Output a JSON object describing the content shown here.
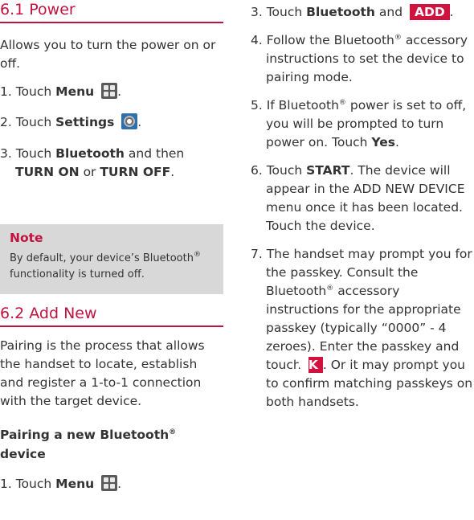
{
  "left": {
    "power_heading": "6.1 Power",
    "power_intro": "Allows you to turn the power on or off.",
    "power_step1_prefix": "1. Touch",
    "power_step1_menu": "Menu",
    "power_step2_prefix": "2. Touch",
    "power_step2_settings": "Settings",
    "power_step3_prefix": "3. Touch",
    "power_step3_bluetooth": "Bluetooth",
    "power_step3_mid": "and then",
    "power_step3_on": "TURN ON",
    "power_step3_or": "or",
    "power_step3_off": "TURN OFF",
    "power_step3_end": ".",
    "note_title": "Note",
    "note_text_1": "By default, your device’s Bluetooth",
    "note_text_2": "functionality is turned off.",
    "add_heading": "6.2 Add New",
    "add_intro": "Pairing is the process that allows the handset to locate, establish and register a 1-to-1 connection with the target device.",
    "pair_heading_1": "Pairing a new Bluetooth",
    "pair_heading_2": "device",
    "add_step1_prefix": "1. Touch",
    "add_step1_menu": "Menu"
  },
  "right": {
    "step3_prefix": "3. Touch",
    "step3_bluetooth": "Bluetooth",
    "step3_mid": "and",
    "step3_button": "ADD",
    "step4": "4. Follow the Bluetooth",
    "step4_rest": "accessory instructions to set the device to pairing mode.",
    "step5_a": "5. If Bluetooth",
    "step5_b": "power is set to off, you will be prompted to turn power on. Touch",
    "step5_yes": "Yes",
    "step6_prefix": "6. Touch",
    "step6_start": "START",
    "step6_rest": ". The device will appear in the ADD NEW DEVICE menu once it has been located. Touch the device.",
    "step7_a": "7. The handset may prompt you for the passkey. Consult the Bluetooth",
    "step7_b": "accessory instructions for the appropriate passkey (typically “0000” - 4 zeroes). Enter the passkey and touch",
    "step7_button": "OK",
    "step7_c": "Or it may prompt you to confirm matching passkeys on both handsets."
  },
  "symbols": {
    "registered": "®"
  },
  "colors": {
    "heading_red": "#c2123f",
    "button_red": "#d1123f",
    "note_bg": "#d8d8d8"
  }
}
